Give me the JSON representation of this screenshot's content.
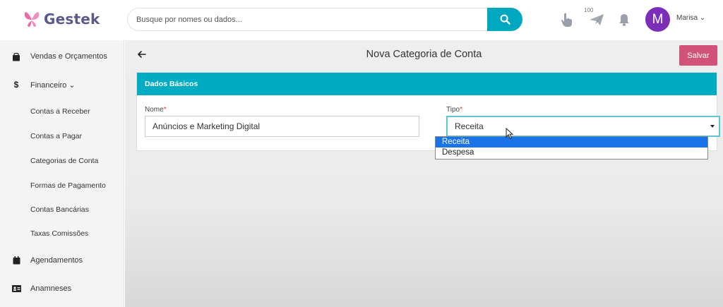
{
  "app": {
    "name": "Gestek",
    "brand_color": "#00acc1",
    "accent_color": "#d1537a"
  },
  "search": {
    "placeholder": "Busque por nomes ou dados...",
    "value": ""
  },
  "topbar": {
    "badge": "100",
    "user_initial": "M",
    "user_name": "Marisa ⌄"
  },
  "sidebar": {
    "items": [
      {
        "label": "Vendas e Orçamentos",
        "icon": "shopping-bag-icon"
      },
      {
        "label": "Financeiro ⌄",
        "icon": "dollar-icon"
      },
      {
        "label": "Contas a Receber"
      },
      {
        "label": "Contas a Pagar"
      },
      {
        "label": "Categorias de Conta"
      },
      {
        "label": "Formas de Pagamento"
      },
      {
        "label": "Contas Bancárias"
      },
      {
        "label": "Taxas Comissões"
      },
      {
        "label": "Agendamentos",
        "icon": "calendar-icon"
      },
      {
        "label": "Anamneses",
        "icon": "id-card-icon"
      }
    ]
  },
  "page": {
    "title": "Nova Categoria de Conta",
    "save_label": "Salvar"
  },
  "form": {
    "section_title": "Dados Básicos",
    "name_label": "Nome",
    "name_value": "Anúncios e Marketing Digital",
    "type_label": "Tipo",
    "type_value": "Receita",
    "required_mark": "*",
    "type_options": [
      "Receita",
      "Despesa"
    ]
  }
}
